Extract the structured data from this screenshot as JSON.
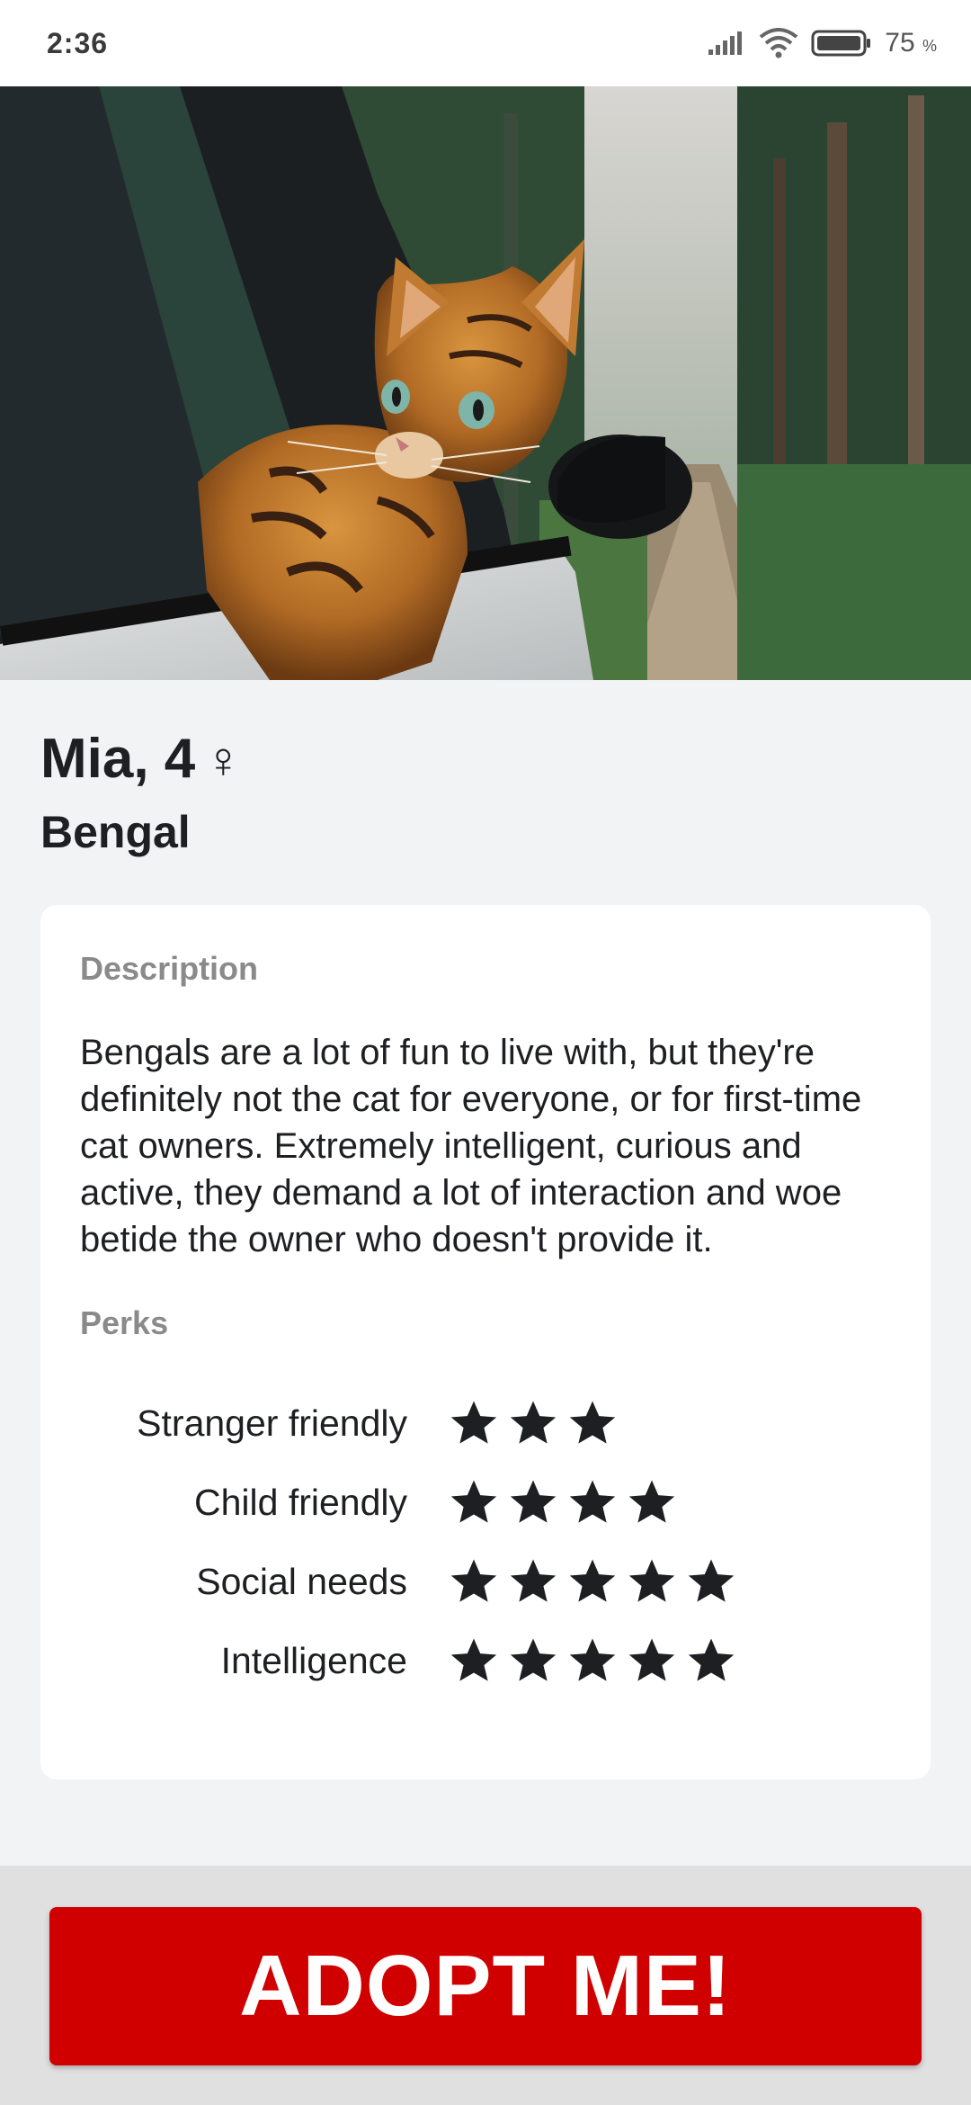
{
  "status_bar": {
    "time": "2:36",
    "battery": "75",
    "battery_unit": "%",
    "icons": [
      "signal-icon",
      "wifi-icon",
      "battery-icon"
    ]
  },
  "hero": {
    "image_alt": "Bengal cat looking out of a car window in a forest"
  },
  "pet": {
    "name_age": "Mia, 4",
    "gender_symbol": "♀",
    "breed": "Bengal"
  },
  "card": {
    "description_label": "Description",
    "description": "Bengals are a lot of fun to live with, but they're definitely not the cat for everyone, or for first-time cat owners. Extremely intelligent, curious and active, they demand a lot of interaction and woe betide the owner who doesn't provide it.",
    "perks_label": "Perks",
    "perks": [
      {
        "label": "Stranger friendly",
        "rating": 3
      },
      {
        "label": "Child friendly",
        "rating": 4
      },
      {
        "label": "Social needs",
        "rating": 5
      },
      {
        "label": "Intelligence",
        "rating": 5
      }
    ]
  },
  "actions": {
    "adopt_label": "ADOPT ME!"
  },
  "colors": {
    "accent": "#d10000",
    "background": "#f2f3f5",
    "card": "#ffffff",
    "label_gray": "#8a8a8a",
    "star": "#1e1f22"
  }
}
